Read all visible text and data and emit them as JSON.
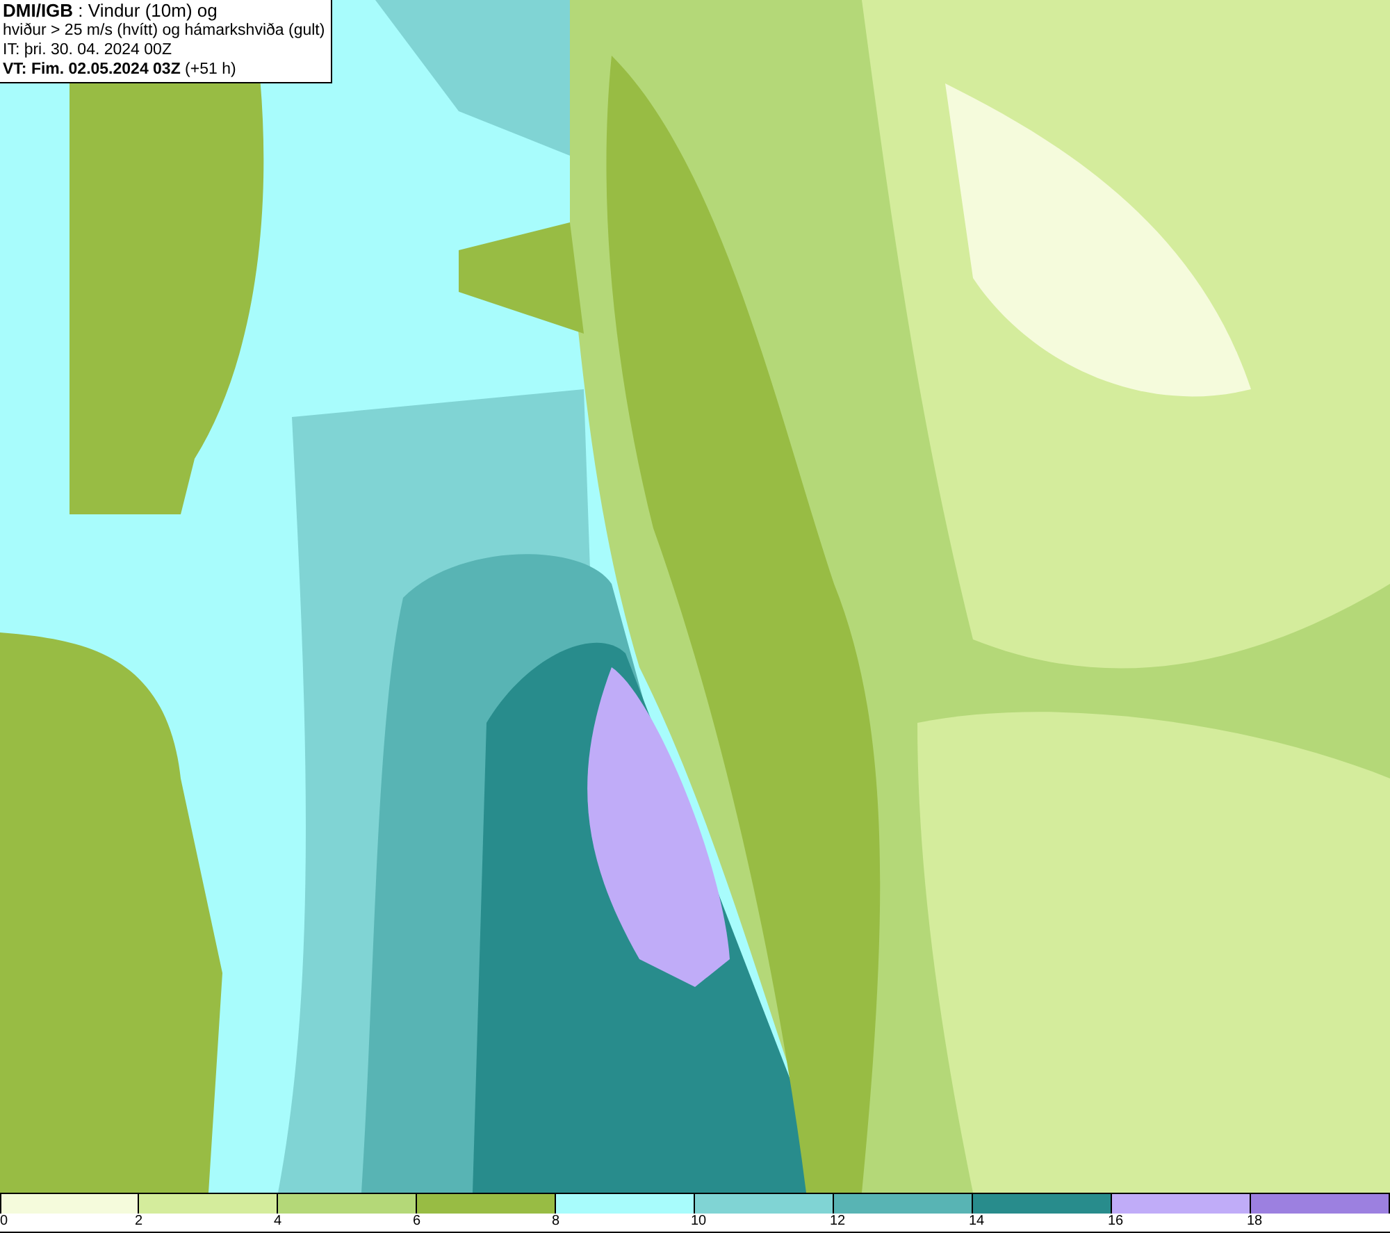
{
  "header": {
    "lines": [
      "**DMI/IGB** : Vindur (10m) og",
      "hviður > 25 m/s (hvítt) og hámarkshviða (gult)",
      "IT: þri. 30. 04. 2024 00Z",
      "**VT: Fim. 02.05.2024 03Z** (+51 h)"
    ]
  },
  "legend": {
    "bins": [
      {
        "label": "0",
        "color": "#f5fbdc"
      },
      {
        "label": "2",
        "color": "#d4ec9c"
      },
      {
        "label": "4",
        "color": "#b4d878"
      },
      {
        "label": "6",
        "color": "#98bc44"
      },
      {
        "label": "8",
        "color": "#a8fcfc"
      },
      {
        "label": "10",
        "color": "#80d4d4"
      },
      {
        "label": "12",
        "color": "#58b4b4"
      },
      {
        "label": "14",
        "color": "#288c8c"
      },
      {
        "label": "16",
        "color": "#c0acf8"
      },
      {
        "label": "18",
        "color": "#9c80e0"
      }
    ]
  }
}
